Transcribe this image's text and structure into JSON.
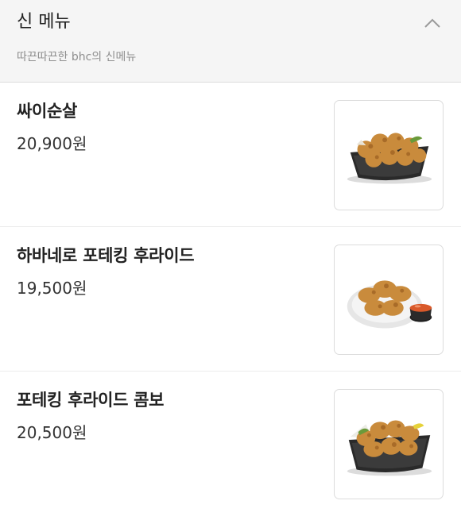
{
  "section": {
    "title": "신 메뉴",
    "subtitle": "따끈따끈한 bhc의 신메뉴",
    "toggle_icon": "chevron-up-icon"
  },
  "menu": {
    "items": [
      {
        "name": "싸이순살",
        "price": "20,900원",
        "image": "boneless-chicken-in-basket"
      },
      {
        "name": "하바네로 포테킹 후라이드",
        "price": "19,500원",
        "image": "fried-chicken-on-plate-with-dip"
      },
      {
        "name": "포테킹 후라이드 콤보",
        "price": "20,500원",
        "image": "fried-chicken-combo-in-basket"
      }
    ]
  },
  "colors": {
    "header_bg": "#f5f5f5",
    "title": "#222222",
    "subtitle": "#8e8e8e",
    "divider": "#dcdcdc",
    "chicken": "#c98b3c"
  }
}
